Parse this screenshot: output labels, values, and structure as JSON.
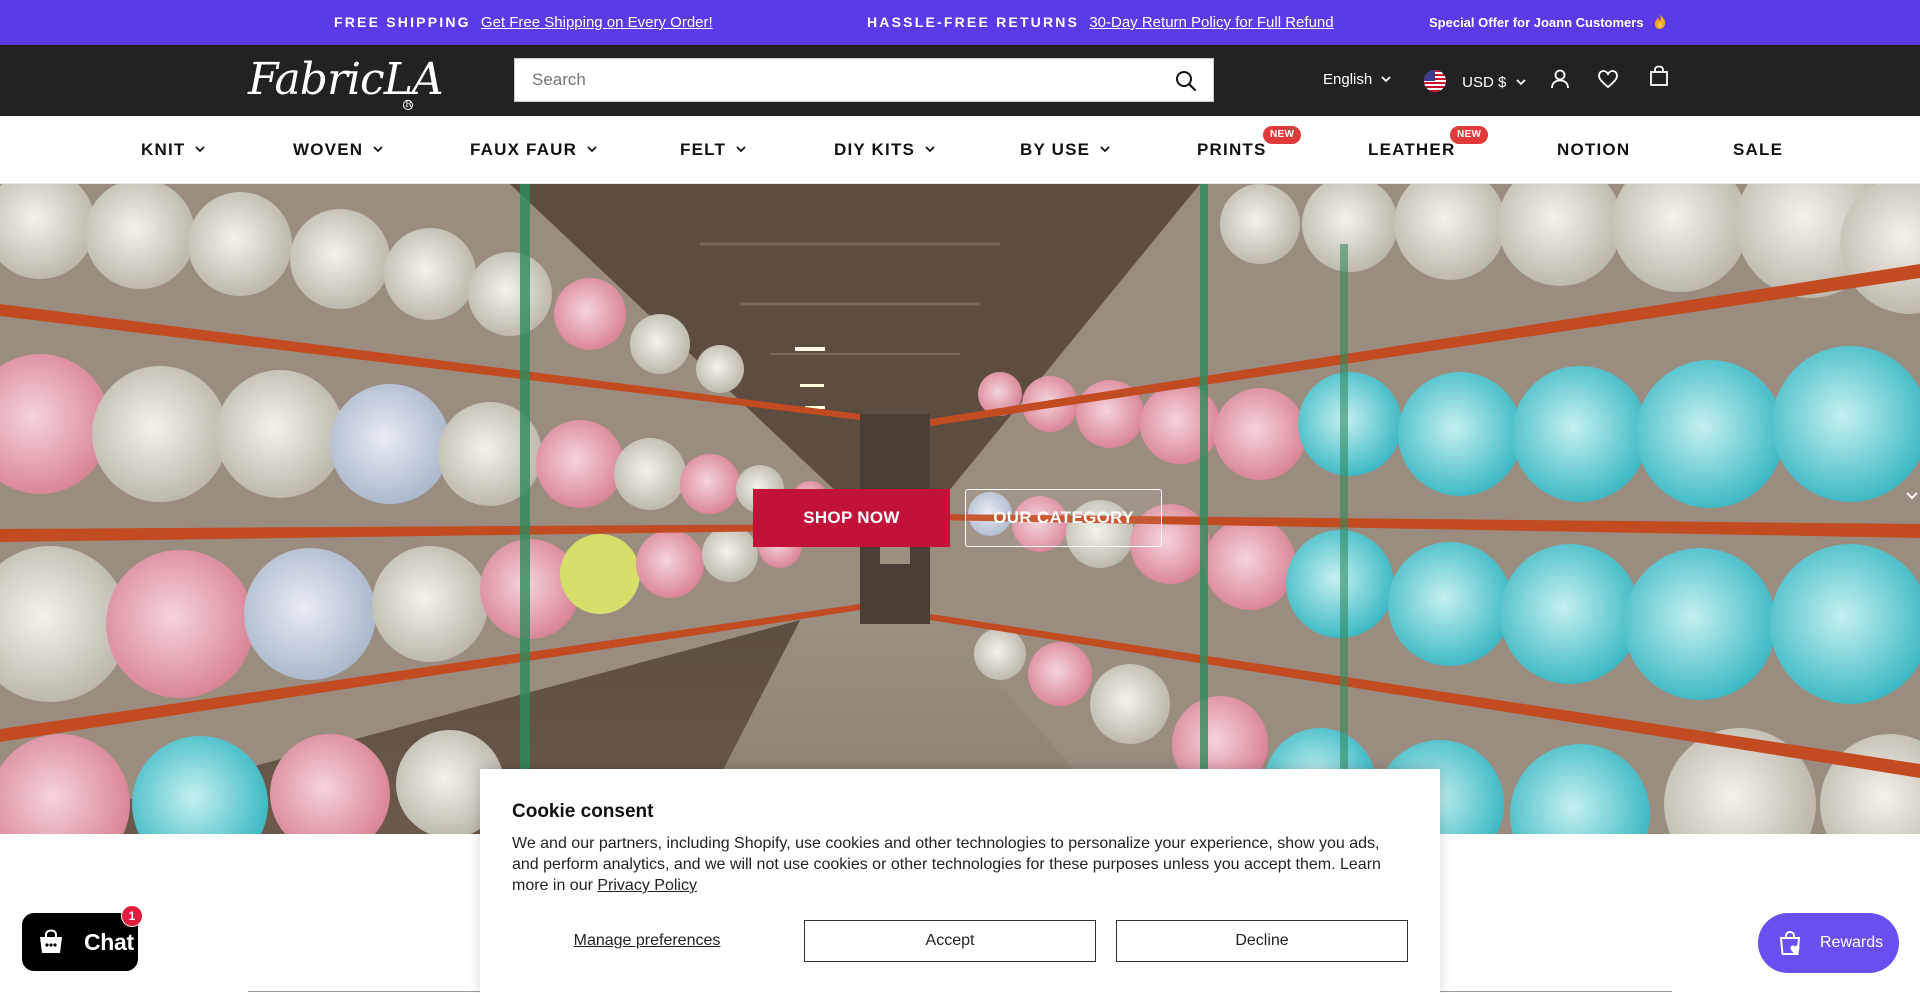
{
  "announcement": {
    "free_shipping_label": "FREE SHIPPING",
    "free_shipping_link": "Get Free Shipping on Every Order!",
    "returns_label": "HASSLE-FREE RETURNS",
    "returns_link": "30-Day Return Policy for Full Refund",
    "special_offer": "Special Offer for Joann Customers",
    "background_color": "#5b3ae8"
  },
  "header": {
    "logo_text": "FabricLA",
    "search_placeholder": "Search",
    "language": "English",
    "currency": "USD $",
    "icons": [
      "search-icon",
      "chevron-down-icon",
      "us-flag-icon",
      "account-icon",
      "wishlist-heart-icon",
      "cart-bag-icon"
    ]
  },
  "nav": {
    "items": [
      {
        "label": "KNIT"
      },
      {
        "label": "WOVEN"
      },
      {
        "label": "FAUX FAUR"
      },
      {
        "label": "FELT"
      },
      {
        "label": "DIY KITS"
      },
      {
        "label": "BY USE"
      },
      {
        "label": "PRINTS",
        "badge": "NEW"
      },
      {
        "label": "LEATHER",
        "badge": "NEW"
      },
      {
        "label": "NOTION"
      },
      {
        "label": "SALE"
      }
    ]
  },
  "hero": {
    "shop_now": "SHOP NOW",
    "our_category": "OUR CATEGORY",
    "accent_color": "#c2123a"
  },
  "cookie": {
    "title": "Cookie consent",
    "body": "We and our partners, including Shopify, use cookies and other technologies to personalize your experience, show you ads, and perform analytics, and we will not use cookies or other technologies for these purposes unless you accept them. Learn more in our",
    "privacy_link": "Privacy Policy",
    "manage": "Manage preferences",
    "accept": "Accept",
    "decline": "Decline"
  },
  "chat": {
    "label": "Chat",
    "count": "1"
  },
  "rewards": {
    "label": "Rewards",
    "color": "#6b4ef0"
  }
}
